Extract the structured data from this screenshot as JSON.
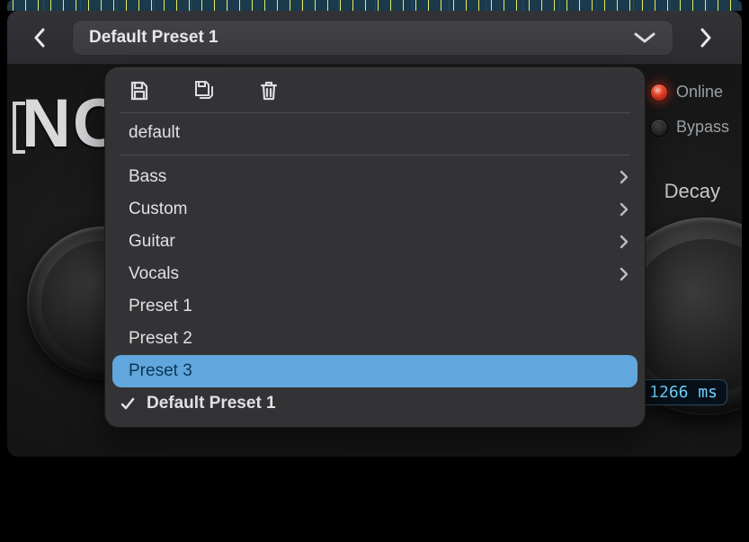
{
  "chrome": {
    "preset_display": "Default Preset 1"
  },
  "brand_fragment": "NC",
  "menu": {
    "default_label": "default",
    "categories": [
      {
        "label": "Bass"
      },
      {
        "label": "Custom"
      },
      {
        "label": "Guitar"
      },
      {
        "label": "Vocals"
      }
    ],
    "presets": [
      {
        "label": "Preset 1",
        "selected": false
      },
      {
        "label": "Preset 2",
        "selected": false
      },
      {
        "label": "Preset 3",
        "selected": true
      }
    ],
    "current": {
      "label": "Default Preset 1"
    }
  },
  "status": {
    "online_label": "Online",
    "bypass_label": "Bypass"
  },
  "decay": {
    "label": "Decay",
    "value_display": "1266 ms"
  }
}
